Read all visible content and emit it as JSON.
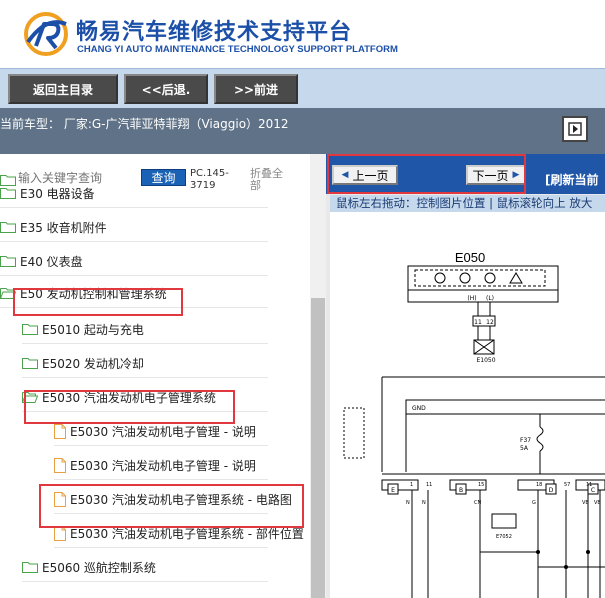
{
  "header": {
    "title": "畅易汽车维修技术支持平台",
    "subtitle": "CHANG YI AUTO MAINTENANCE TECHNOLOGY SUPPORT PLATFORM"
  },
  "nav": {
    "home": "返回主目录",
    "back": "<<后退.",
    "forward": ">>前进"
  },
  "car": {
    "info": "当前车型： 厂家:G-广汽菲亚特菲翔（Viaggio）2012"
  },
  "search": {
    "placeholder": "输入关键字查询",
    "button": "查询",
    "code": "PC.145-3719",
    "collapse": "折叠全部"
  },
  "tree": [
    {
      "label": "E30 电器设备",
      "type": "folder",
      "level": 0
    },
    {
      "label": "E35 收音机附件",
      "type": "folder",
      "level": 0
    },
    {
      "label": "E40 仪表盘",
      "type": "folder",
      "level": 0
    },
    {
      "label": "E50 发动机控制和管理系统",
      "type": "folder-open",
      "level": 0
    },
    {
      "label": "E5010 起动与充电",
      "type": "folder",
      "level": 1
    },
    {
      "label": "E5020 发动机冷却",
      "type": "folder",
      "level": 1
    },
    {
      "label": "E5030 汽油发动机电子管理系统",
      "type": "folder-open",
      "level": 1
    },
    {
      "label": "E5030 汽油发动机电子管理 - 说明",
      "type": "doc",
      "level": 2
    },
    {
      "label": "E5030 汽油发动机电子管理 - 说明",
      "type": "doc",
      "level": 2
    },
    {
      "label": "E5030 汽油发动机电子管理系统 - 电路图",
      "type": "doc",
      "level": 2
    },
    {
      "label": "E5030 汽油发动机电子管理系统 - 部件位置",
      "type": "doc",
      "level": 2
    },
    {
      "label": "E5060 巡航控制系统",
      "type": "folder",
      "level": 1
    }
  ],
  "viewer": {
    "prev": "上一页",
    "next": "下一页",
    "refresh": "[刷新当前",
    "hint": "鼠标左右拖动：控制图片位置 | 鼠标滚轮向上 放大"
  },
  "diagram": {
    "component": "E050",
    "sub": "E1050",
    "gnd": "GND",
    "fuse": "F37",
    "fuse_rating": "5A",
    "e7052": "E7052",
    "pins": [
      "11",
      "12"
    ],
    "terms": [
      "(H)",
      "(L)"
    ],
    "connectors": [
      "E",
      "B",
      "D",
      "C"
    ],
    "pin_nums": [
      "1",
      "11",
      "15",
      "18",
      "57",
      "11"
    ],
    "wires": [
      "N",
      "N",
      "CN",
      "G",
      "VB",
      "VB"
    ]
  },
  "colors": {
    "brand": "#1c50a8",
    "navbar": "#c5d8ec",
    "carbar": "#5f7287",
    "highlight": "#e0383e",
    "viewer_bar": "#1f56a8"
  }
}
